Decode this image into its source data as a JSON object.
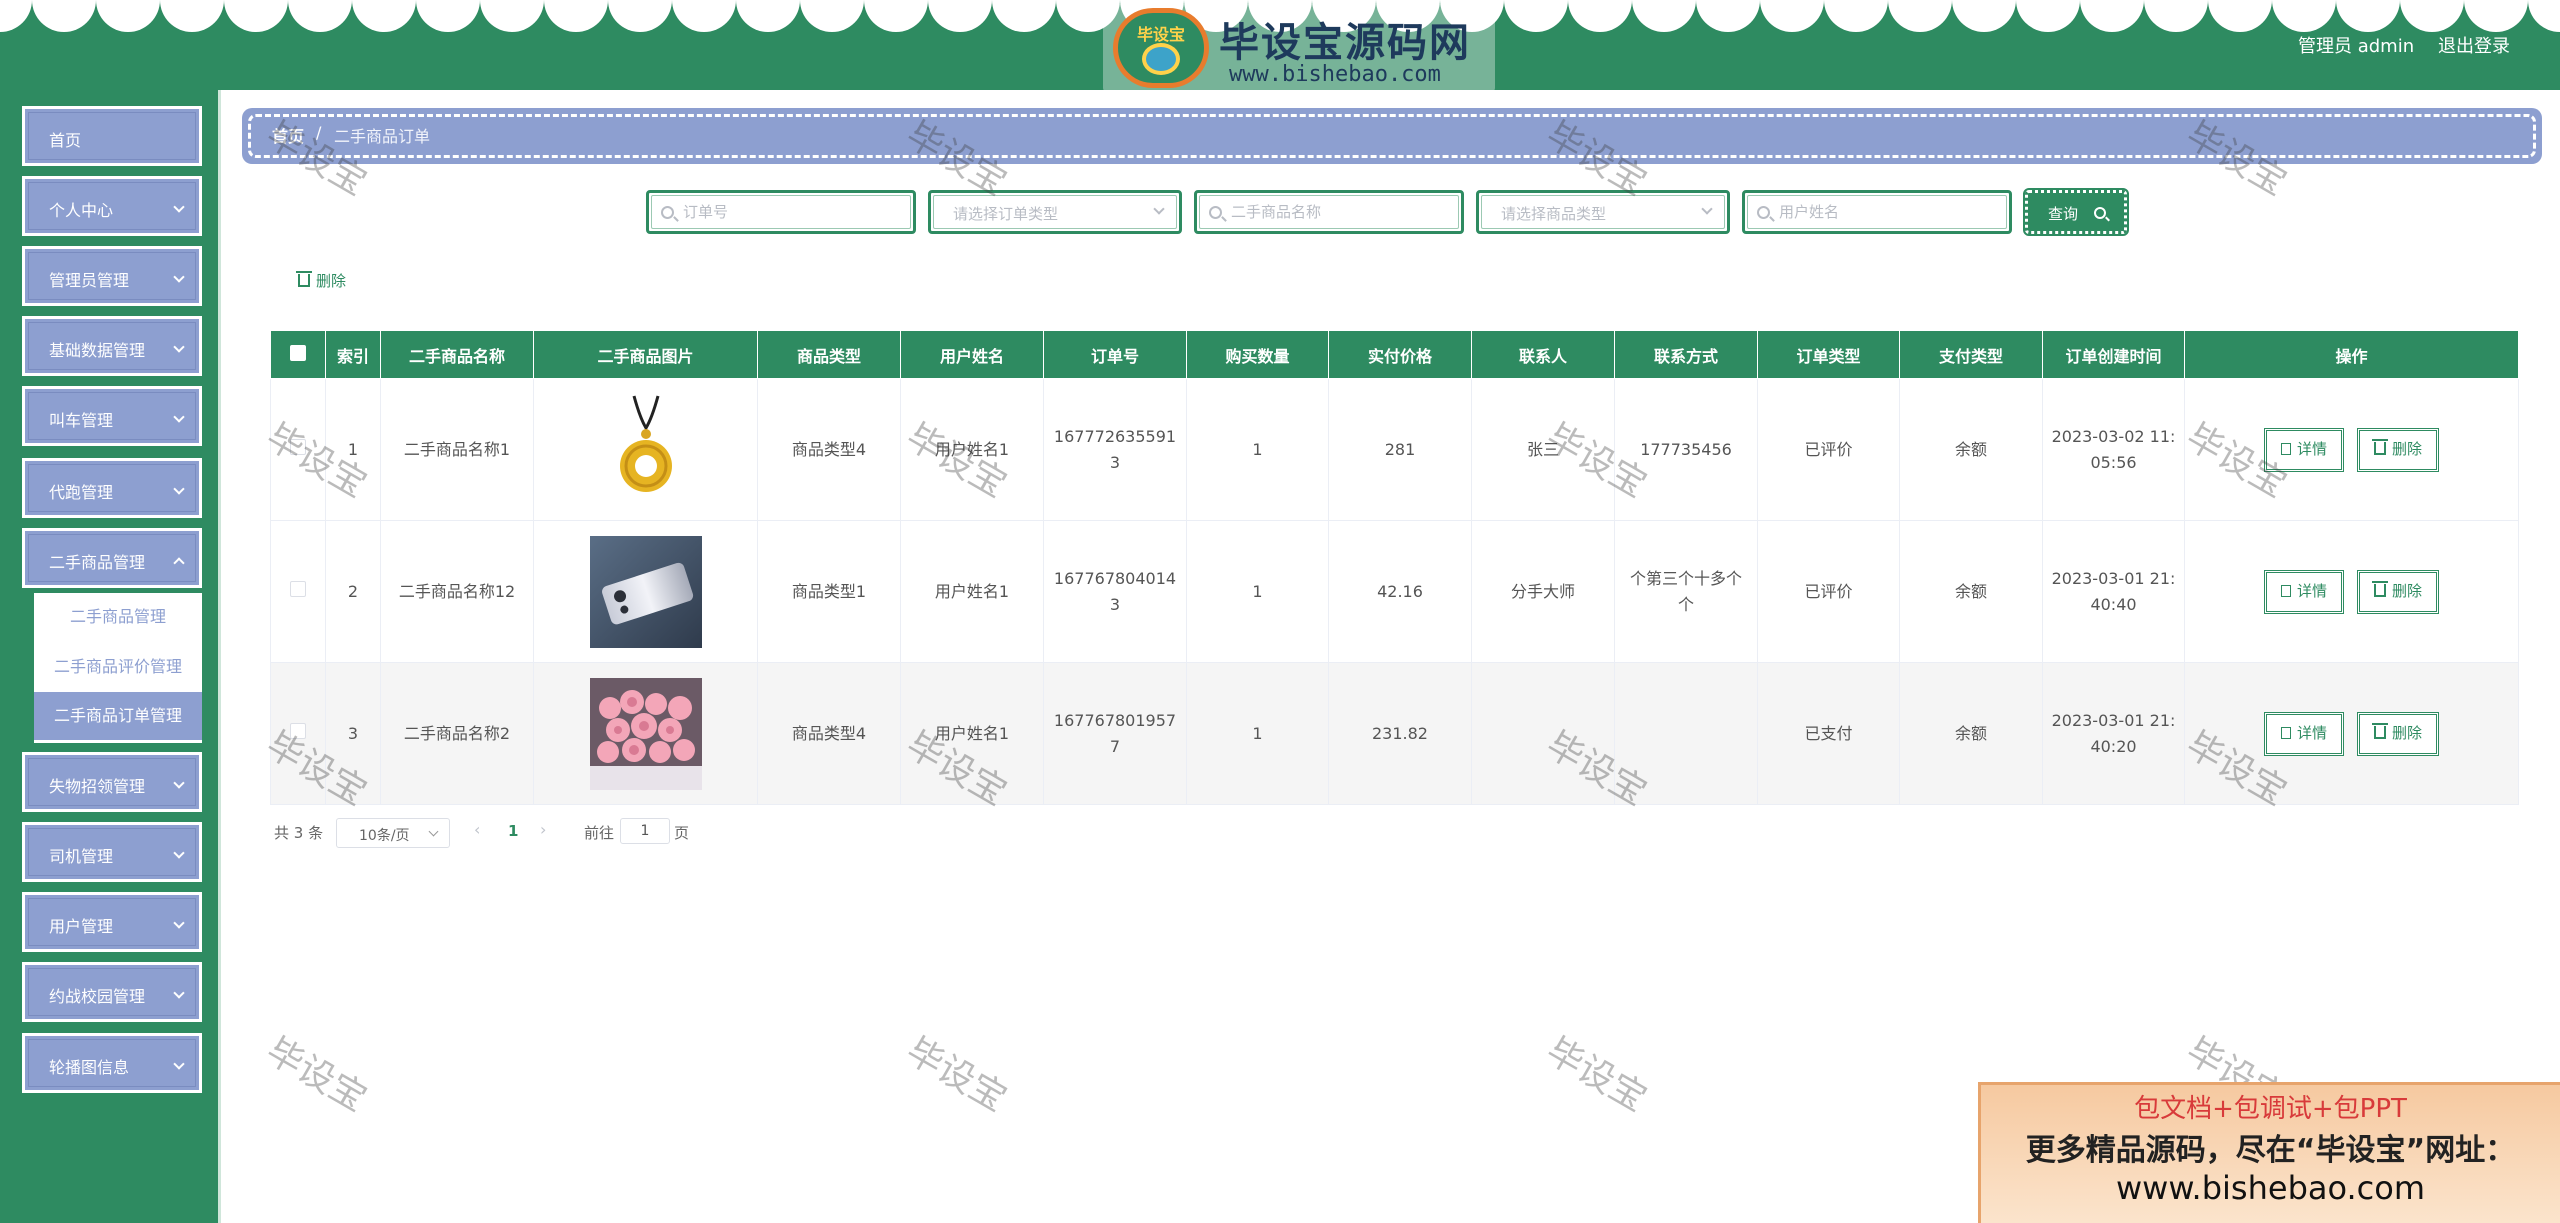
{
  "brand": {
    "badge": "毕设宝",
    "title": "毕设宝源码网",
    "url": "www.bishebao.com"
  },
  "header": {
    "user": "管理员 admin",
    "logout": "退出登录"
  },
  "sidebar": {
    "items": [
      {
        "label": "首页"
      },
      {
        "label": "个人中心"
      },
      {
        "label": "管理员管理"
      },
      {
        "label": "基础数据管理"
      },
      {
        "label": "叫车管理"
      },
      {
        "label": "代跑管理"
      },
      {
        "label": "二手商品管理"
      },
      {
        "label": "失物招领管理"
      },
      {
        "label": "司机管理"
      },
      {
        "label": "用户管理"
      },
      {
        "label": "约战校园管理"
      },
      {
        "label": "轮播图信息"
      }
    ],
    "submenu": [
      {
        "label": "二手商品管理"
      },
      {
        "label": "二手商品评价管理"
      },
      {
        "label": "二手商品订单管理"
      }
    ]
  },
  "breadcrumb": {
    "home": "首页",
    "sep": "/",
    "current": "二手商品订单"
  },
  "search": {
    "order_no_placeholder": "订单号",
    "order_type_placeholder": "请选择订单类型",
    "goods_name_placeholder": "二手商品名称",
    "goods_type_placeholder": "请选择商品类型",
    "user_name_placeholder": "用户姓名",
    "query_label": "查询"
  },
  "toolbar": {
    "delete_label": "删除"
  },
  "table": {
    "columns": [
      "索引",
      "二手商品名称",
      "二手商品图片",
      "商品类型",
      "用户姓名",
      "订单号",
      "购买数量",
      "实付价格",
      "联系人",
      "联系方式",
      "订单类型",
      "支付类型",
      "订单创建时间",
      "操作"
    ],
    "rows": [
      {
        "index": "1",
        "name": "二手商品名称1",
        "image": "gold-pendant",
        "type": "商品类型4",
        "user": "用户姓名1",
        "order_no": "1677726355913",
        "qty": "1",
        "price": "281",
        "contact": "张三",
        "phone": "177735456",
        "order_type": "已评价",
        "pay_type": "余额",
        "created": "2023-03-02 11:05:56"
      },
      {
        "index": "2",
        "name": "二手商品名称12",
        "image": "phone",
        "type": "商品类型1",
        "user": "用户姓名1",
        "order_no": "1677678040143",
        "qty": "1",
        "price": "42.16",
        "contact": "分手大师",
        "phone": "个第三个十多个个",
        "order_type": "已评价",
        "pay_type": "余额",
        "created": "2023-03-01 21:40:40"
      },
      {
        "index": "3",
        "name": "二手商品名称2",
        "image": "flower-bouquet",
        "type": "商品类型4",
        "user": "用户姓名1",
        "order_no": "1677678019577",
        "qty": "1",
        "price": "231.82",
        "contact": "",
        "phone": "",
        "order_type": "已支付",
        "pay_type": "余额",
        "created": "2023-03-01 21:40:20"
      }
    ],
    "detail_label": "详情",
    "delete_label": "删除"
  },
  "pagination": {
    "total": "共 3 条",
    "page_size": "10条/页",
    "current_page": "1",
    "goto_label": "前往",
    "goto_value": "1",
    "page_unit": "页"
  },
  "watermark": "毕设宝",
  "ad": {
    "line1": "包文档+包调试+包PPT",
    "line2": "更多精品源码，尽在“毕设宝”网址：",
    "line3": "www.bishebao.com"
  },
  "colors": {
    "primary": "#2e8b61",
    "accent": "#8d9fd0"
  }
}
